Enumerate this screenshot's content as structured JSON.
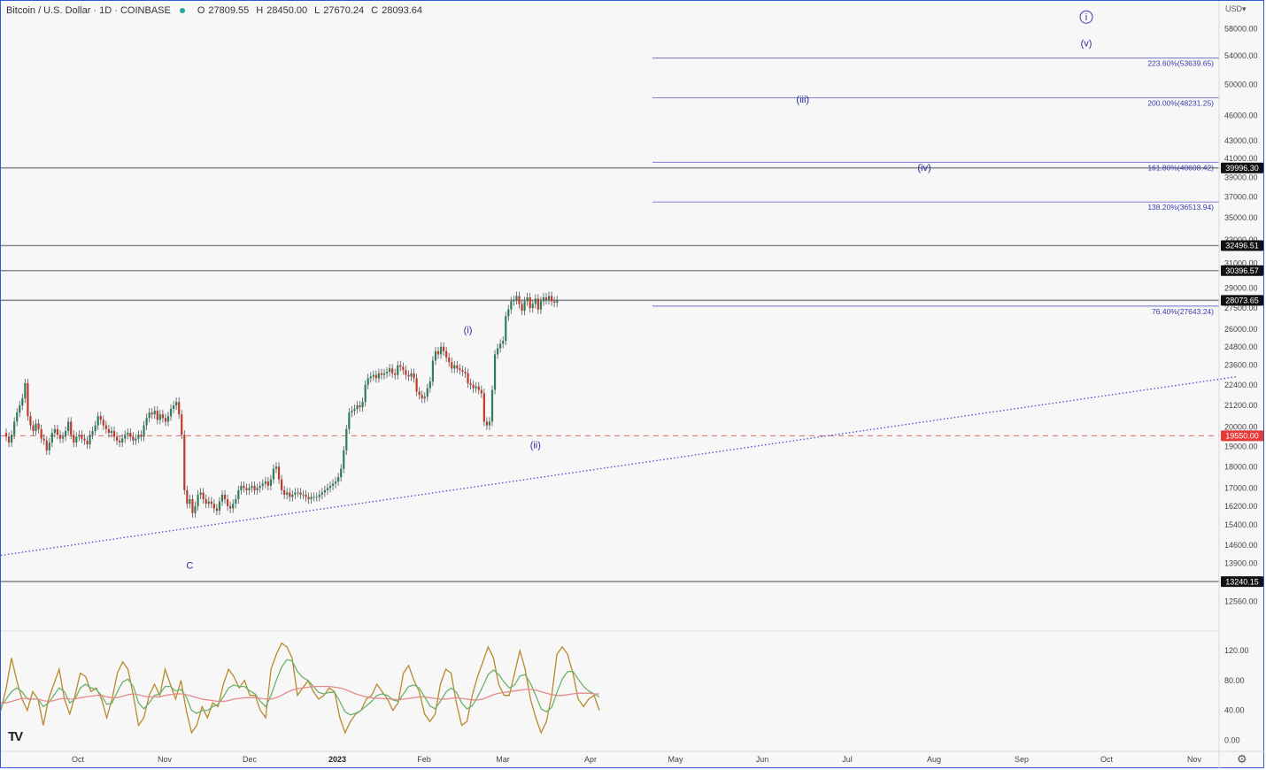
{
  "header": {
    "symbol": "Bitcoin / U.S. Dollar · 1D · COINBASE",
    "status_color": "#26a69a",
    "o_label": "O",
    "o_value": "27809.55",
    "h_label": "H",
    "h_value": "28450.00",
    "l_label": "L",
    "l_value": "27670.24",
    "c_label": "C",
    "c_value": "28093.64"
  },
  "currency": "USD",
  "logo_text": "TV",
  "icons": {
    "settings": "gear-icon",
    "currency_menu": "chevron-down-icon"
  },
  "chart_data": {
    "type": "candlestick",
    "price_axis": {
      "scale": "log",
      "ylim": [
        11600,
        62500
      ],
      "ticks": [
        "58000.00",
        "54000.00",
        "50000.00",
        "46000.00",
        "43000.00",
        "41000.00",
        "39000.00",
        "37000.00",
        "35000.00",
        "33000.00",
        "31000.00",
        "29000.00",
        "27500.00",
        "26000.00",
        "24800.00",
        "23600.00",
        "22400.00",
        "21200.00",
        "20000.00",
        "19000.00",
        "18000.00",
        "17000.00",
        "16200.00",
        "15400.00",
        "14600.00",
        "13900.00",
        "12560.00"
      ]
    },
    "time_axis": {
      "labels": [
        "Oct",
        "Nov",
        "Dec",
        "2023",
        "Feb",
        "Mar",
        "Apr",
        "May",
        "Jun",
        "Jul",
        "Aug",
        "Sep",
        "Oct",
        "Nov"
      ],
      "bold": [
        "2023"
      ]
    },
    "candles_close": [
      19500,
      19200,
      19600,
      20300,
      20800,
      21200,
      21600,
      22500,
      20600,
      20100,
      19800,
      20200,
      19900,
      19400,
      19300,
      18800,
      19200,
      19700,
      19900,
      19600,
      19400,
      19500,
      19800,
      20300,
      19600,
      19200,
      19500,
      19600,
      19400,
      19300,
      19100,
      19600,
      19800,
      20100,
      20600,
      20400,
      20100,
      19900,
      19700,
      19800,
      19500,
      19300,
      19200,
      19400,
      19600,
      19700,
      19500,
      19300,
      19400,
      19600,
      19500,
      20100,
      20500,
      20800,
      20700,
      20900,
      20400,
      20700,
      20500,
      20300,
      20600,
      21000,
      21200,
      21400,
      20700,
      19600,
      16900,
      16300,
      16500,
      15900,
      16200,
      16700,
      16800,
      16500,
      16300,
      16400,
      16300,
      16100,
      16000,
      16400,
      16700,
      16500,
      16200,
      16100,
      16300,
      16500,
      16900,
      17100,
      17000,
      16900,
      17000,
      17100,
      16900,
      17000,
      17100,
      17200,
      17300,
      17100,
      17400,
      17900,
      18000,
      17400,
      16900,
      16700,
      16800,
      16600,
      16700,
      16800,
      16800,
      16700,
      16700,
      16600,
      16500,
      16600,
      16600,
      16600,
      16700,
      16800,
      16900,
      17000,
      17100,
      17200,
      17300,
      17500,
      17900,
      18800,
      19900,
      20800,
      20900,
      21000,
      21200,
      21100,
      21400,
      22400,
      22800,
      22900,
      23000,
      22800,
      23100,
      23000,
      23100,
      23200,
      23400,
      23100,
      23000,
      23600,
      23500,
      23300,
      23000,
      22900,
      23100,
      22800,
      22000,
      21800,
      21600,
      21700,
      22200,
      22600,
      23900,
      24500,
      24300,
      24800,
      24500,
      24100,
      23800,
      23400,
      23600,
      23400,
      23300,
      23200,
      23100,
      22500,
      22400,
      22200,
      22300,
      22100,
      21900,
      20300,
      20100,
      20300,
      22100,
      24300,
      24700,
      25000,
      25200,
      26900,
      27400,
      28000,
      28100,
      28400,
      27800,
      27300,
      28000,
      28300,
      27500,
      27800,
      28200,
      27400,
      28000,
      28300,
      28100,
      28400,
      28000,
      27900,
      28093.64
    ],
    "wave_labels": [
      {
        "label": "C",
        "price": 13700,
        "bar": 68
      },
      {
        "label": "(i)",
        "price": 25700,
        "bar": 171
      },
      {
        "label": "(ii)",
        "price": 18900,
        "bar": 196
      },
      {
        "label": "(iii)",
        "price": 47600,
        "bar": 295
      },
      {
        "label": "(iv)",
        "price": 39700,
        "bar": 340
      },
      {
        "label": "(v)",
        "price": 55300,
        "bar": 400
      },
      {
        "label": "i",
        "price": 59300,
        "bar": 400,
        "circled": true
      }
    ],
    "fib_levels": [
      {
        "label": "223.60%(53639.65)",
        "price": 53639.65
      },
      {
        "label": "200.00%(48231.25)",
        "price": 48231.25
      },
      {
        "label": "161.80%(40608.42)",
        "price": 40608.42
      },
      {
        "label": "138.20%(36513.94)",
        "price": 36513.94
      },
      {
        "label": "76.40%(27643.24)",
        "price": 27643.24
      }
    ],
    "horizontal_levels": [
      {
        "label": "39996.30",
        "price": 39996.3
      },
      {
        "label": "32496.51",
        "price": 32496.51
      },
      {
        "label": "30396.57",
        "price": 30396.57
      },
      {
        "label": "28073.65",
        "price": 28073.65
      },
      {
        "label": "13240.15",
        "price": 13240.15
      }
    ],
    "dashed_level": {
      "label": "19550.00",
      "price": 19550.0,
      "color": "#e06666"
    },
    "trendline": {
      "from": {
        "bar": -2,
        "price": 14200
      },
      "to": {
        "bar": 456,
        "price": 22900
      },
      "color": "#4b4bd0"
    },
    "oscillator": {
      "ylim": [
        -15,
        145
      ],
      "ticks": [
        "120.00",
        "80.00",
        "40.00",
        "0.00"
      ],
      "series": [
        {
          "color": "#b8892c",
          "values": [
            40,
            70,
            110,
            80,
            55,
            40,
            65,
            55,
            20,
            55,
            75,
            95,
            55,
            35,
            60,
            90,
            85,
            65,
            70,
            55,
            30,
            55,
            90,
            105,
            95,
            60,
            20,
            30,
            60,
            75,
            60,
            95,
            75,
            55,
            80,
            40,
            10,
            20,
            45,
            30,
            50,
            45,
            75,
            95,
            85,
            70,
            80,
            60,
            60,
            40,
            30,
            95,
            115,
            130,
            125,
            110,
            60,
            70,
            80,
            65,
            55,
            60,
            70,
            65,
            30,
            10,
            25,
            35,
            40,
            55,
            60,
            75,
            65,
            55,
            40,
            50,
            90,
            100,
            80,
            65,
            35,
            25,
            35,
            75,
            95,
            90,
            50,
            20,
            25,
            60,
            85,
            105,
            125,
            110,
            75,
            60,
            60,
            90,
            120,
            95,
            55,
            30,
            10,
            25,
            60,
            115,
            125,
            115,
            90,
            55,
            45,
            55,
            60,
            40
          ]
        },
        {
          "color": "#6bb36b",
          "values": [
            45,
            55,
            65,
            70,
            65,
            55,
            55,
            55,
            45,
            50,
            60,
            70,
            65,
            50,
            55,
            70,
            75,
            70,
            68,
            60,
            48,
            50,
            65,
            78,
            82,
            72,
            50,
            42,
            50,
            60,
            62,
            72,
            72,
            66,
            68,
            58,
            40,
            36,
            40,
            40,
            45,
            48,
            58,
            70,
            74,
            72,
            72,
            66,
            62,
            52,
            45,
            60,
            80,
            98,
            108,
            106,
            92,
            84,
            80,
            72,
            64,
            62,
            64,
            64,
            52,
            38,
            34,
            36,
            40,
            46,
            52,
            60,
            62,
            60,
            54,
            52,
            62,
            72,
            74,
            70,
            58,
            46,
            42,
            52,
            64,
            70,
            64,
            50,
            42,
            46,
            58,
            72,
            88,
            94,
            88,
            78,
            70,
            74,
            86,
            88,
            76,
            60,
            42,
            38,
            44,
            64,
            82,
            92,
            92,
            82,
            72,
            66,
            62,
            58
          ]
        },
        {
          "color": "#e58a8a",
          "values": [
            50,
            50,
            52,
            54,
            56,
            56,
            55,
            55,
            53,
            52,
            53,
            55,
            56,
            55,
            55,
            57,
            58,
            59,
            60,
            60,
            58,
            57,
            57,
            59,
            61,
            62,
            61,
            59,
            58,
            58,
            58,
            60,
            61,
            62,
            62,
            61,
            59,
            57,
            55,
            54,
            53,
            52,
            52,
            53,
            55,
            56,
            57,
            57,
            57,
            56,
            55,
            55,
            57,
            60,
            64,
            67,
            69,
            70,
            71,
            72,
            72,
            72,
            72,
            71,
            70,
            68,
            65,
            62,
            60,
            58,
            57,
            56,
            56,
            55,
            55,
            54,
            55,
            56,
            57,
            58,
            58,
            57,
            56,
            55,
            55,
            56,
            57,
            56,
            55,
            54,
            54,
            55,
            58,
            61,
            63,
            64,
            65,
            66,
            67,
            68,
            68,
            67,
            65,
            63,
            61,
            60,
            60,
            61,
            62,
            63,
            63,
            63,
            62,
            62
          ]
        }
      ]
    }
  }
}
